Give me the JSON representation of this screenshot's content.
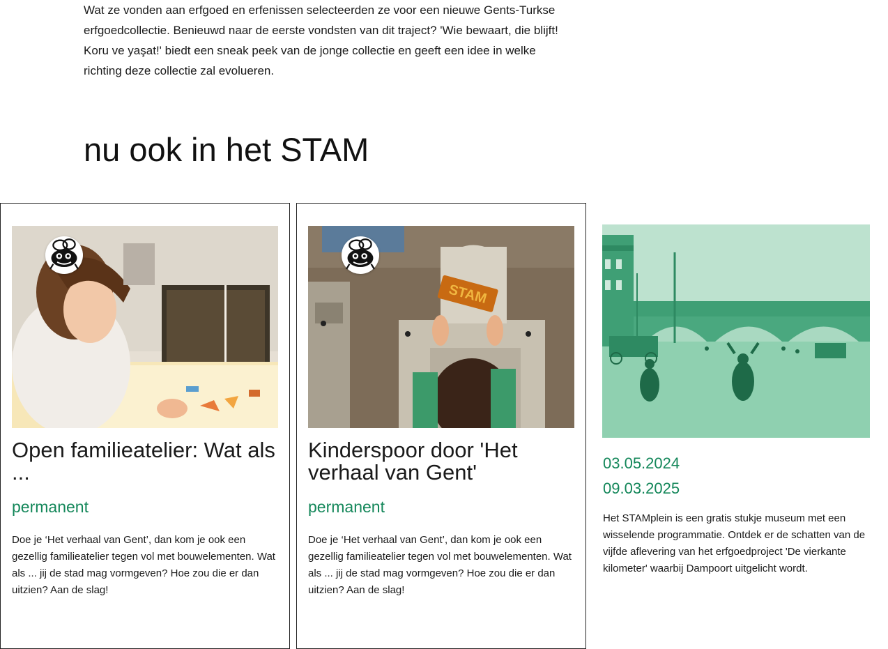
{
  "intro": {
    "text": "Wat ze vonden aan erfgoed en erfenissen selecteerden ze voor een nieuwe Gents-Turkse erfgoedcollectie. Benieuwd naar de eerste vondsten van dit traject? 'Wie bewaart, die blijft! Koru ve yaşat!' biedt een sneak peek van de jonge collectie en geeft een idee in welke richting deze collectie zal evolueren."
  },
  "section": {
    "title": "nu ook in het STAM"
  },
  "cards": [
    {
      "title": "Open familieatelier: Wat als ...",
      "date": "permanent",
      "description": "Doe je ‘Het verhaal van Gent’, dan kom je ook een gezellig familieatelier tegen vol met bouwelementen. Wat als ... jij de stad mag vormgeven? Hoe zou die er dan uitzien? Aan de slag!",
      "badge_icon": "bee-mascot-icon"
    },
    {
      "title": "Kinderspoor door 'Het verhaal van Gent'",
      "date": "permanent",
      "description": "Doe je ‘Het verhaal van Gent’, dan kom je ook een gezellig familieatelier tegen vol met bouwelementen. Wat als ... jij de stad mag vormgeven? Hoe zou die er dan uitzien? Aan de slag!",
      "badge_icon": "bee-mascot-icon",
      "image_sign": "STAM"
    },
    {
      "date_start": "03.05.2024",
      "date_end": "09.03.2025",
      "description": "Het STAMplein is een gratis stukje museum met een wisselende programmatie. Ontdek er de schatten van de vijfde aflevering van het erfgoedproject 'De vierkante kilometer' waarbij Dampoort uitgelicht wordt."
    }
  ],
  "colors": {
    "accent": "#14875a",
    "tint": "#4fb890"
  }
}
